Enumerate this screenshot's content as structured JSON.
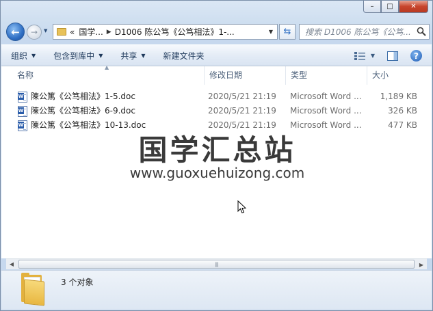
{
  "window": {
    "caption_buttons": {
      "minimize": "–",
      "maximize": "□",
      "close": "✕"
    }
  },
  "nav": {
    "address": {
      "overflow": "«",
      "crumbs": [
        "国学...",
        "D1006 陈公笃《公笃相法》1-..."
      ]
    },
    "search_placeholder": "搜索 D1006 陈公笃《公笃..."
  },
  "toolbar": {
    "organize": "组织",
    "include_in_library": "包含到库中",
    "share": "共享",
    "new_folder": "新建文件夹"
  },
  "columns": {
    "name": "名称",
    "date": "修改日期",
    "type": "类型",
    "size": "大小"
  },
  "files": [
    {
      "name": "陳公篤《公笃相法》1-5.doc",
      "date": "2020/5/21 21:19",
      "type": "Microsoft Word ...",
      "size": "1,189 KB"
    },
    {
      "name": "陳公篤《公笃相法》6-9.doc",
      "date": "2020/5/21 21:19",
      "type": "Microsoft Word ...",
      "size": "326 KB"
    },
    {
      "name": "陳公篤《公笃相法》10-13.doc",
      "date": "2020/5/21 21:19",
      "type": "Microsoft Word ...",
      "size": "477 KB"
    }
  ],
  "watermark": {
    "title": "国学汇总站",
    "url": "www.guoxuehuizong.com"
  },
  "status": {
    "count": "3 个对象"
  },
  "icons": {
    "back": "back-arrow-icon",
    "forward": "forward-arrow-icon",
    "refresh": "refresh-icon",
    "search": "search-icon",
    "help": "help-icon",
    "view": "view-options-icon",
    "preview": "preview-pane-icon",
    "doc": "word-document-icon",
    "folder": "folder-icon"
  },
  "colors": {
    "accent": "#2f6fc4",
    "chrome": "#cfdff0",
    "close": "#c7442c",
    "folder": "#e3b13e"
  }
}
